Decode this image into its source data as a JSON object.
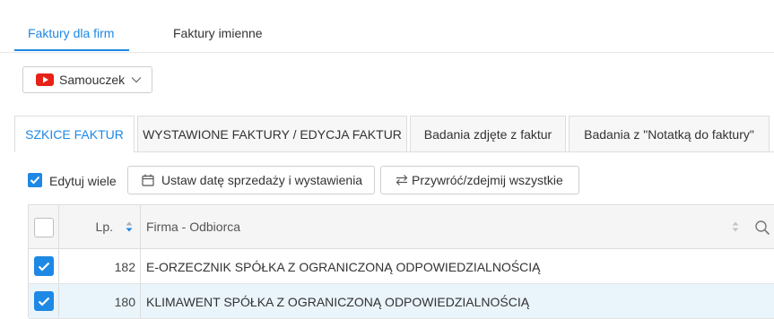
{
  "top_tabs": [
    {
      "label": "Faktury dla firm",
      "active": true
    },
    {
      "label": "Faktury imienne",
      "active": false
    }
  ],
  "tutorial": {
    "label": "Samouczek",
    "icon": "youtube-icon"
  },
  "sub_tabs": [
    {
      "label": "SZKICE FAKTUR",
      "active": true
    },
    {
      "label": "WYSTAWIONE FAKTURY / EDYCJA FAKTUR",
      "active": false
    },
    {
      "label": "Badania zdjęte z faktur",
      "active": false
    },
    {
      "label": "Badania z \"Notatką do faktury\"",
      "active": false
    }
  ],
  "toolbar": {
    "edit_many_label": "Edytuj wiele",
    "edit_many_checked": true,
    "set_date_label": "Ustaw datę sprzedaży i wystawienia",
    "restore_label": "Przywróć/zdejmij wszystkie"
  },
  "table": {
    "columns": [
      "",
      "Lp.",
      "Firma - Odbiorca"
    ],
    "rows": [
      {
        "checked": true,
        "lp": "182",
        "firma": "E-ORZECZNIK SPÓŁKA Z OGRANICZONĄ ODPOWIEDZIALNOŚCIĄ"
      },
      {
        "checked": true,
        "lp": "180",
        "firma": "KLIMAWENT SPÓŁKA Z OGRANICZONĄ ODPOWIEDZIALNOŚCIĄ"
      }
    ]
  },
  "colors": {
    "accent": "#1e88e5",
    "youtube": "#e62117",
    "row_highlight": "#eaf4fb"
  }
}
